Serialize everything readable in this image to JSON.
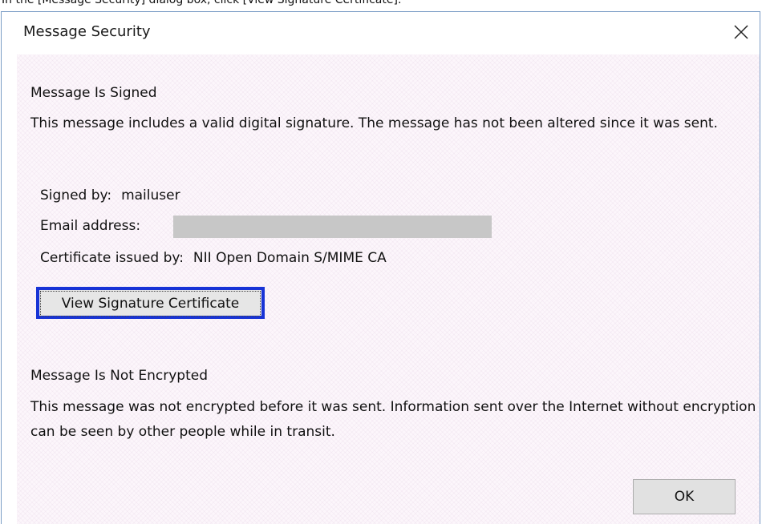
{
  "instruction_caption": "In the [Message Security] dialog box, click [View Signature Certificate].",
  "dialog": {
    "title": "Message Security",
    "close_icon": "close-icon"
  },
  "signed_section": {
    "heading": "Message Is Signed",
    "description": "This message includes a valid digital signature. The message has not been altered since it was sent.",
    "signed_by_label": "Signed by:",
    "signed_by_value": "mailuser",
    "email_label": "Email address:",
    "issuer_label": "Certificate issued by:",
    "issuer_value": "NII Open Domain S/MIME CA",
    "view_cert_button": "View Signature Certificate"
  },
  "encryption_section": {
    "heading": "Message Is Not Encrypted",
    "description": "This message was not encrypted before it was sent. Information sent over the Internet without encryption can be seen by other people while in transit."
  },
  "ok_button": "OK",
  "colors": {
    "focus_border": "#1733d6",
    "content_bg": "#fcf6fb",
    "redaction": "#c7c7c7"
  }
}
